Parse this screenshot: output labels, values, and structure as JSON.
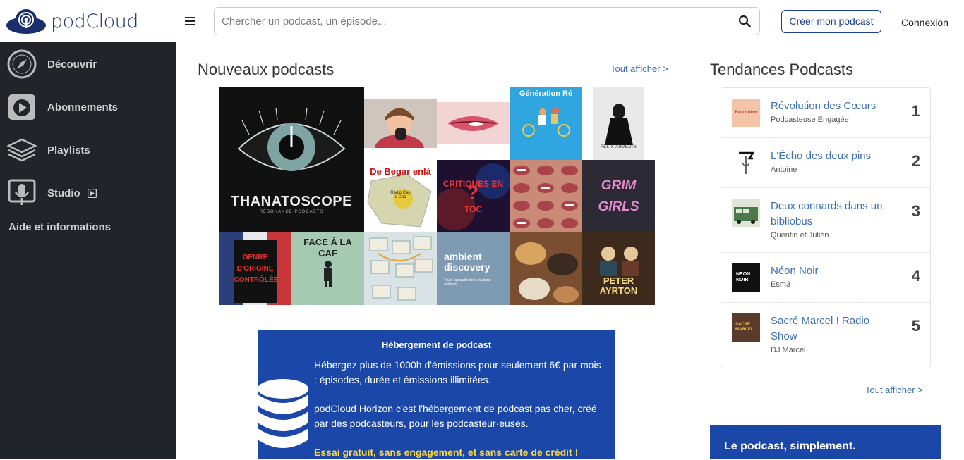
{
  "header": {
    "logo_text": "podCloud",
    "search_placeholder": "Chercher un podcast, un épisode...",
    "create_label": "Créer mon podcast",
    "login_label": "Connexion"
  },
  "sidebar": {
    "items": [
      {
        "label": "Découvrir",
        "icon": "compass-icon"
      },
      {
        "label": "Abonnements",
        "icon": "play-icon"
      },
      {
        "label": "Playlists",
        "icon": "layers-icon"
      },
      {
        "label": "Studio",
        "icon": "microphone-icon"
      }
    ],
    "help_label": "Aide et informations"
  },
  "new_podcasts": {
    "title": "Nouveaux podcasts",
    "see_all": "Tout afficher >",
    "tiles": [
      {
        "name": "thanatoscope",
        "text": "THANATOSCOPE",
        "subtext": "RÉSONANCE PODCASTS",
        "bg": "#111111"
      },
      {
        "name": "woman-mic",
        "text": "",
        "bg": "#d9c6b4"
      },
      {
        "name": "lips",
        "text": "",
        "bg": "#e8c6c8"
      },
      {
        "name": "generation-re",
        "text": "Génération Ré",
        "bg": "#2fa6e0"
      },
      {
        "name": "felix",
        "text": "FÉLIX ARVEDIN",
        "bg": "#e9e9e9"
      },
      {
        "name": "de-begar-enla",
        "text": "De Begar enlà",
        "subtext": "Ràdio Cap e Cap",
        "bg": "#ffffff"
      },
      {
        "name": "critiques-en-toc",
        "text": "CRITIQUES EN TOC",
        "bg": "#2a1448"
      },
      {
        "name": "mouths",
        "text": "",
        "bg": "#c98a78"
      },
      {
        "name": "grim-girls",
        "text": "GRIM GIRLS",
        "bg": "#2b2a35"
      },
      {
        "name": "genre-origine",
        "text": "GENRE D'ORIGINE CONTRÔLÉE",
        "bg": "#2c3f7a"
      },
      {
        "name": "face-caf",
        "text": "FACE À LA CAF",
        "bg": "#a6c9b3"
      },
      {
        "name": "map-cards",
        "text": "",
        "bg": "#c6d2d6"
      },
      {
        "name": "ambient-discovery",
        "text": "ambient discovery",
        "subtext": "Toute l'actualité de la musique ambient",
        "bg": "#7f9ab3"
      },
      {
        "name": "seeds",
        "text": "",
        "bg": "#9a6a44"
      },
      {
        "name": "peter-ayrton",
        "text": "PETER AYRTON",
        "bg": "#3e2a1c"
      }
    ]
  },
  "promo": {
    "title": "Hébergement de podcast",
    "p1": "Hébergez plus de 1000h d'émissions pour seulement 6€ par mois : épisodes, durée et émissions illimitées.",
    "p2": "podCloud Horizon c'est l'hébergement de podcast pas cher, créé par des podcasteurs, pour les podcasteur·euses.",
    "cta": "Essai gratuit, sans engagement, et sans carte de crédit !"
  },
  "trends": {
    "title": "Tendances Podcasts",
    "see_all": "Tout afficher >",
    "items": [
      {
        "rank": "1",
        "title": "Révolution des Cœurs",
        "author": "Podcasteuse Engagée",
        "thumb_bg": "#f4c4a8",
        "thumb_text": "Révolution"
      },
      {
        "rank": "2",
        "title": "L'Écho des deux pins",
        "author": "Antoine",
        "thumb_bg": "#ffffff",
        "thumb_text": ""
      },
      {
        "rank": "3",
        "title": "Deux connards dans un bibliobus",
        "author": "Quentin et Julien",
        "thumb_bg": "#4a7a4a",
        "thumb_text": ""
      },
      {
        "rank": "4",
        "title": "Néon Noir",
        "author": "Esm3",
        "thumb_bg": "#111111",
        "thumb_text": "NEON NOIR"
      },
      {
        "rank": "5",
        "title": "Sacré Marcel ! Radio Show",
        "author": "DJ Marcel",
        "thumb_bg": "#5a3a2a",
        "thumb_text": "SACRÉ MARCEL"
      }
    ]
  },
  "bottom_card": {
    "text": "Le podcast, simplement."
  },
  "colors": {
    "brand": "#1a2e6e",
    "link": "#3a6fb5",
    "sidebar": "#212529",
    "promo": "#1a47a8",
    "cta": "#ffd83a"
  }
}
